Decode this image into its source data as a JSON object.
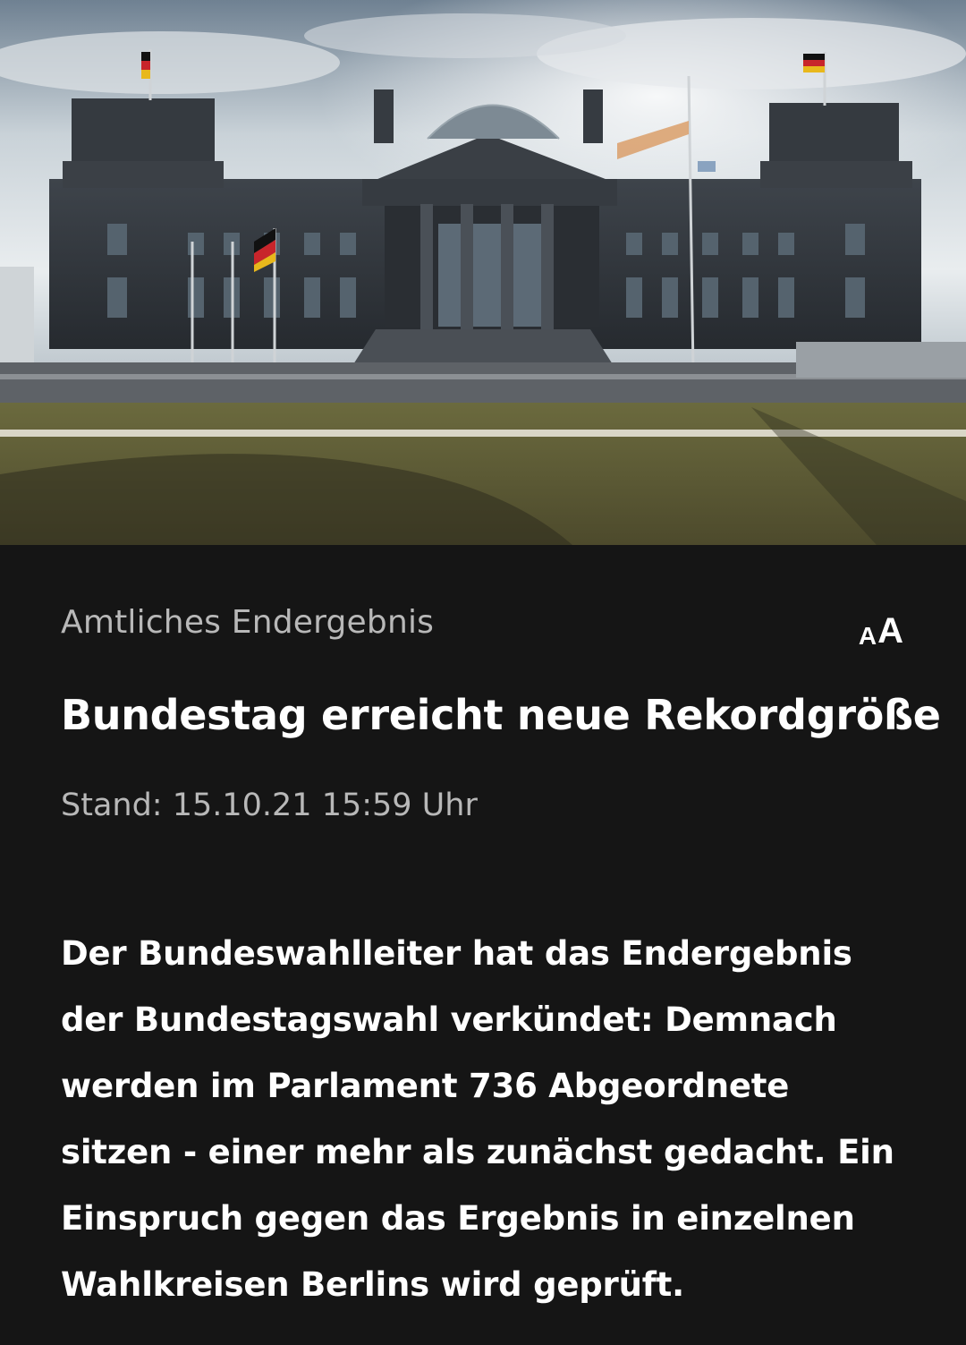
{
  "hero_image": {
    "alt_subject": "Reichstag building"
  },
  "article": {
    "topline": "Amtliches Endergebnis",
    "font_size_toggle": {
      "small": "A",
      "large": "A"
    },
    "headline": "Bundestag erreicht neue Rekordgröße",
    "stand": "Stand: 15.10.21 15:59 Uhr",
    "lead": "Der Bundeswahlleiter hat das Endergebnis der Bundestagswahl verkündet: Demnach werden im Parlament 736 Abgeordnete sitzen - einer mehr als zunächst gedacht. Ein Einspruch gegen das Ergebnis in einzelnen Wahlkreisen Berlins wird geprüft."
  },
  "colors": {
    "background": "#151515",
    "text_primary": "#ffffff",
    "text_secondary": "#b8b8b8"
  }
}
